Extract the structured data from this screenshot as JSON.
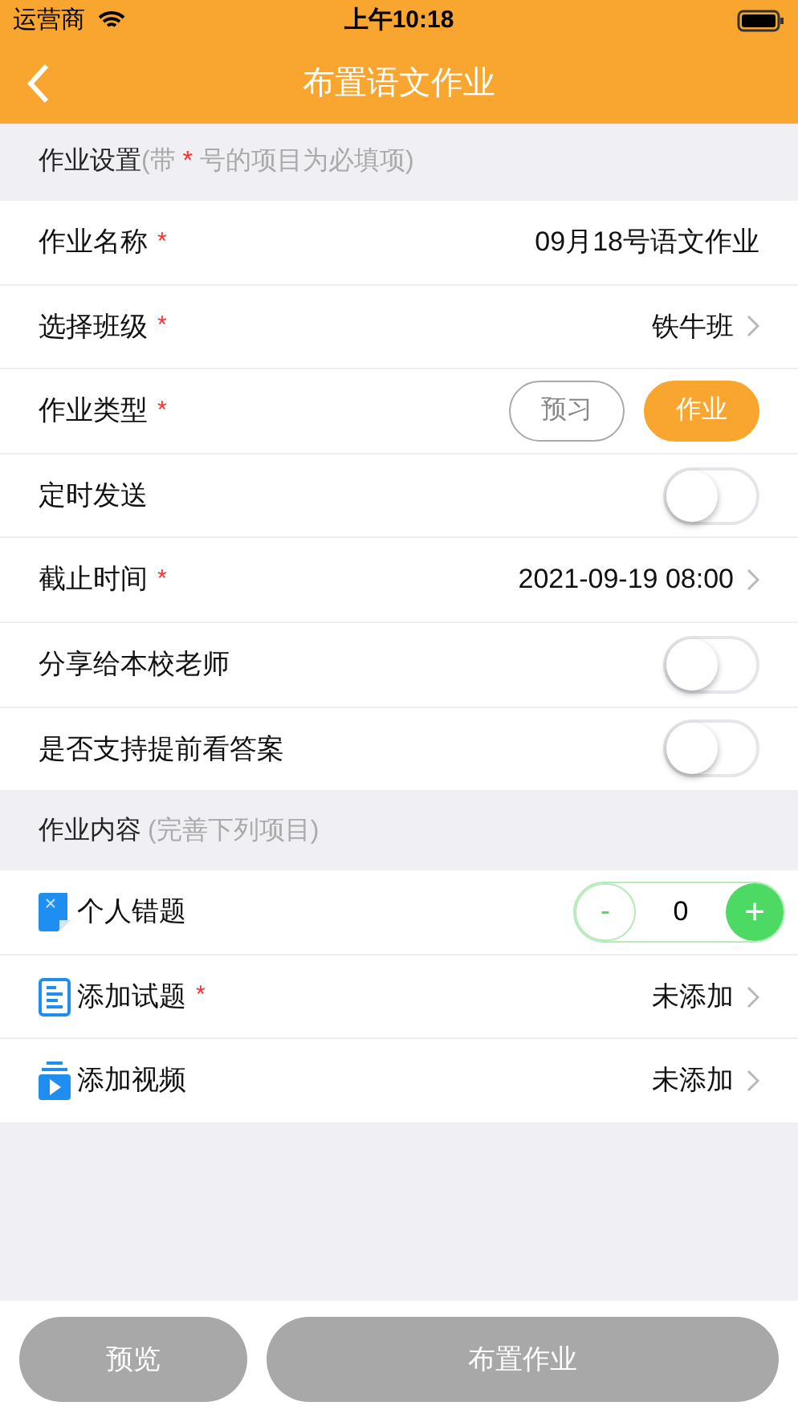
{
  "status_bar": {
    "carrier": "运营商",
    "time": "上午10:18"
  },
  "nav": {
    "title": "布置语文作业"
  },
  "settings_section": {
    "title": "作业设置",
    "hint_before": "(带 ",
    "hint_star": "*",
    "hint_after": " 号的项目为必填项)"
  },
  "settings": [
    {
      "kind": "text",
      "label": "作业名称",
      "required": true,
      "value": "09月18号语文作业"
    },
    {
      "kind": "chevron",
      "label": "选择班级",
      "required": true,
      "value": "铁牛班"
    },
    {
      "kind": "segment",
      "label": "作业类型",
      "required": true,
      "options": [
        {
          "label": "预习",
          "selected": false
        },
        {
          "label": "作业",
          "selected": true
        }
      ]
    },
    {
      "kind": "toggle",
      "label": "定时发送",
      "required": false,
      "on": false
    },
    {
      "kind": "chevron",
      "label": "截止时间",
      "required": true,
      "value": "2021-09-19 08:00"
    },
    {
      "kind": "toggle",
      "label": "分享给本校老师",
      "required": false,
      "on": false
    },
    {
      "kind": "toggle",
      "label": "是否支持提前看答案",
      "required": false,
      "on": false
    }
  ],
  "content_section": {
    "title": "作业内容",
    "hint": "(完善下列项目)"
  },
  "content": [
    {
      "kind": "stepper",
      "label": "个人错题",
      "required": false,
      "minus": "-",
      "count": "0",
      "plus": "+"
    },
    {
      "kind": "chevron",
      "label": "添加试题",
      "required": true,
      "value": "未添加"
    },
    {
      "kind": "chevron",
      "label": "添加视频",
      "required": false,
      "value": "未添加"
    }
  ],
  "buttons": [
    {
      "kind": "preview",
      "label": "预览"
    },
    {
      "kind": "submit",
      "label": "布置作业"
    }
  ]
}
